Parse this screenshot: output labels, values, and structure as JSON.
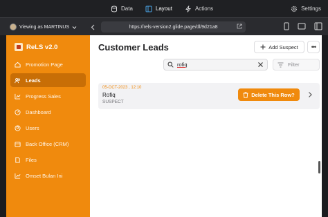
{
  "topbar": {
    "tabs": [
      {
        "label": "Data",
        "icon": "data-icon"
      },
      {
        "label": "Layout",
        "icon": "layout-icon"
      },
      {
        "label": "Actions",
        "icon": "actions-icon"
      }
    ],
    "settings_label": "Settings"
  },
  "urlbar": {
    "viewing_as": "Viewing as MARTINUS",
    "url": "https://rels-version2.glide.page/dl/9d21a8"
  },
  "sidebar": {
    "brand": "ReLS v2.0",
    "items": [
      {
        "label": "Promotion Page",
        "icon": "home-icon"
      },
      {
        "label": "Leads",
        "icon": "users-icon"
      },
      {
        "label": "Progress Sales",
        "icon": "chart-icon"
      },
      {
        "label": "Dashboard",
        "icon": "dashboard-icon"
      },
      {
        "label": "Users",
        "icon": "user-icon"
      },
      {
        "label": "Back Office (CRM)",
        "icon": "calendar-icon"
      },
      {
        "label": "Files",
        "icon": "files-icon"
      },
      {
        "label": "Omset Bulan Ini",
        "icon": "chart-icon"
      }
    ]
  },
  "main": {
    "title": "Customer Leads",
    "add_label": "Add Suspect",
    "more_label": "•••",
    "search_value": "rofiq",
    "filter_label": "Filter",
    "row": {
      "date": "05-OCT-2023 , 12:10",
      "name": "Rofiq",
      "status": "SUSPECT",
      "delete_label": "Delete This Row?"
    }
  },
  "colors": {
    "accent": "#f08a0d",
    "sidebar_active": "#c86e06",
    "chrome_dark": "#1f2023"
  }
}
